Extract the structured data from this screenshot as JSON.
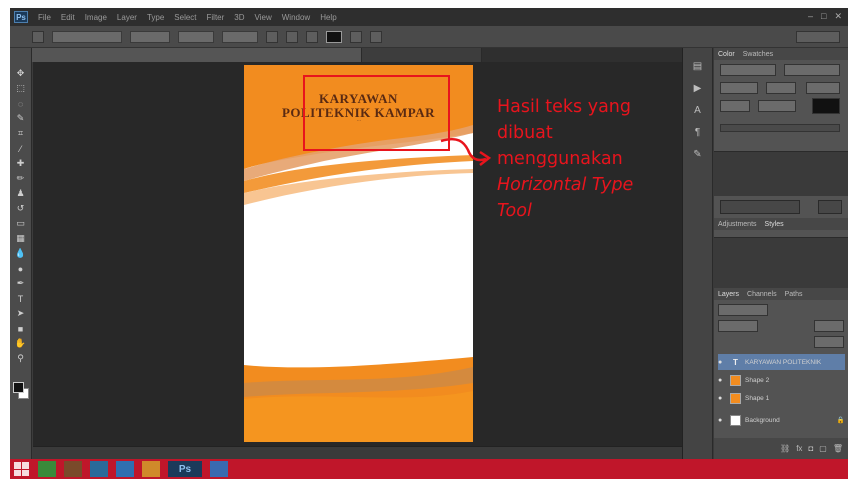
{
  "app": {
    "logo_text": "Ps",
    "menu": [
      "File",
      "Edit",
      "Image",
      "Layer",
      "Type",
      "Select",
      "Filter",
      "3D",
      "View",
      "Window",
      "Help"
    ],
    "workspace": "Essentials"
  },
  "document": {
    "title_line1": "KARYAWAN",
    "title_line2": "POLITEKNIK KAMPAR",
    "subtitle": "..."
  },
  "annotation": {
    "line1": "Hasil teks yang",
    "line2": "dibuat",
    "line3": "menggunakan",
    "line4": "Horizontal Type",
    "line5": "Tool"
  },
  "panels": {
    "color_tabs": [
      "Color",
      "Swatches"
    ],
    "adjust_tabs": [
      "Adjustments",
      "Styles"
    ],
    "layers_tabs": [
      "Layers",
      "Channels",
      "Paths"
    ],
    "layers": [
      {
        "name": "KARYAWAN POLITEKNIK",
        "type": "text",
        "selected": true
      },
      {
        "name": "Shape 2",
        "type": "shape",
        "selected": false
      },
      {
        "name": "Shape 1",
        "type": "shape",
        "selected": false
      },
      {
        "name": "Background",
        "type": "image",
        "selected": false
      }
    ]
  },
  "colors": {
    "accent_orange": "#f28c1f",
    "highlight_red": "#e8141d",
    "taskbar": "#c0162a"
  }
}
